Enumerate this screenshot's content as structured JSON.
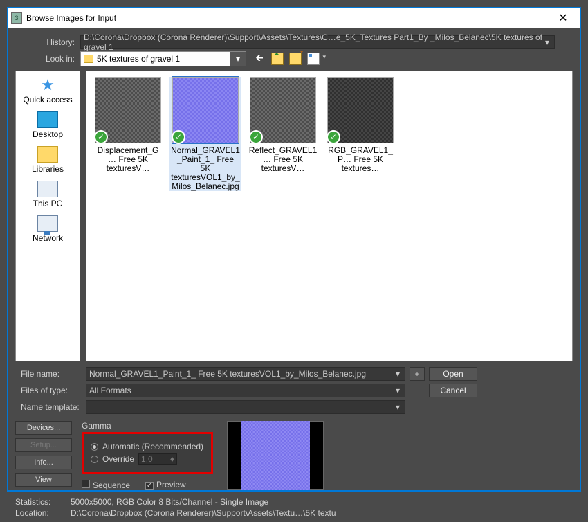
{
  "window": {
    "title": "Browse Images for Input",
    "close_glyph": "✕"
  },
  "app_icon_text": "3",
  "history": {
    "label": "History:",
    "value": "D:\\Corona\\Dropbox (Corona Renderer)\\Support\\Assets\\Textures\\C…e_5K_Textures Part1_By _Milos_Belanec\\5K textures of gravel 1"
  },
  "lookin": {
    "label": "Look in:",
    "value": "5K textures of gravel 1"
  },
  "places": [
    {
      "name": "Quick access",
      "icon": "quick"
    },
    {
      "name": "Desktop",
      "icon": "desk"
    },
    {
      "name": "Libraries",
      "icon": "lib"
    },
    {
      "name": "This PC",
      "icon": "pc"
    },
    {
      "name": "Network",
      "icon": "net"
    }
  ],
  "files": [
    {
      "label": "Displacement_G… Free 5K texturesV…",
      "tex": "gravel",
      "sel": false
    },
    {
      "label": "Normal_GRAVEL1_Paint_1_ Free 5K texturesVOL1_by_Milos_Belanec.jpg",
      "tex": "normal",
      "sel": true
    },
    {
      "label": "Reflect_GRAVEL1… Free 5K texturesV…",
      "tex": "gravel",
      "sel": false
    },
    {
      "label": "RGB_GRAVEL1_P… Free 5K textures…",
      "tex": "dark",
      "sel": false
    }
  ],
  "filename": {
    "label": "File name:",
    "value": "Normal_GRAVEL1_Paint_1_ Free 5K texturesVOL1_by_Milos_Belanec.jpg"
  },
  "filetype": {
    "label": "Files of type:",
    "value": "All Formats"
  },
  "name_template_label": "Name template:",
  "buttons": {
    "open": "Open",
    "cancel": "Cancel",
    "plus": "+"
  },
  "side_buttons": {
    "devices": "Devices...",
    "setup": "Setup...",
    "info": "Info...",
    "view": "View"
  },
  "gamma": {
    "title": "Gamma",
    "auto": "Automatic (Recommended)",
    "override": "Override",
    "value": "1,0"
  },
  "checks": {
    "sequence": "Sequence",
    "preview": "Preview",
    "preview_on": "✓"
  },
  "stats": {
    "label": "Statistics:",
    "value": "5000x5000, RGB Color 8 Bits/Channel - Single Image"
  },
  "loc": {
    "label": "Location:",
    "value": "D:\\Corona\\Dropbox (Corona Renderer)\\Support\\Assets\\Textu…\\5K textu"
  }
}
